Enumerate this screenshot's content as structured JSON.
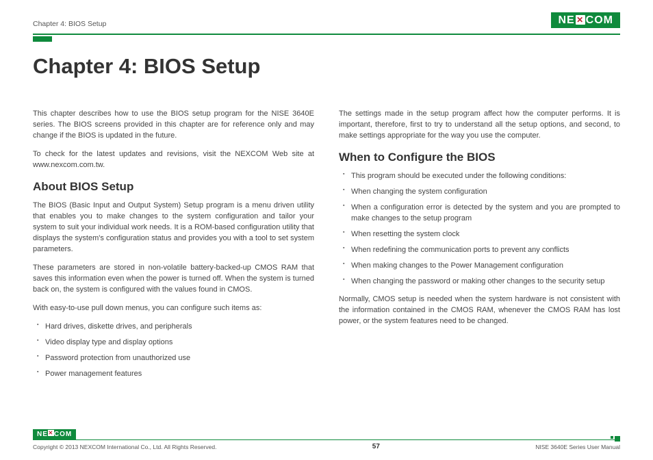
{
  "brand": {
    "pre": "NE",
    "mid": "✕",
    "post": "COM"
  },
  "header": {
    "chapter_ref": "Chapter 4: BIOS Setup"
  },
  "title": "Chapter 4: BIOS Setup",
  "left": {
    "intro1": "This chapter describes how to use the BIOS setup program for the NISE 3640E series. The BIOS screens provided in this chapter are for reference only and may change if the BIOS is updated in the future.",
    "intro2": "To check for the latest updates and revisions, visit the NEXCOM Web site at www.nexcom.com.tw.",
    "h_about": "About BIOS Setup",
    "about1": "The BIOS (Basic Input and Output System) Setup program is a menu driven utility that enables you to make changes to the system configuration and tailor your system to suit your individual work needs. It is a ROM-based configuration utility that displays the system's configuration status and provides you with a tool to set system parameters.",
    "about2": "These parameters are stored in non-volatile battery-backed-up CMOS RAM that saves this information even when the power is turned off. When the system is turned back on, the system is configured with the values found in CMOS.",
    "about3": "With easy-to-use pull down menus, you can configure such items as:",
    "items": [
      "Hard drives, diskette drives, and peripherals",
      "Video display type and display options",
      "Password protection from unauthorized use",
      "Power management features"
    ]
  },
  "right": {
    "intro": "The settings made in the setup program affect how the computer performs. It is important, therefore, first to try to understand all the setup options, and second, to make settings appropriate for the way you use the computer.",
    "h_when": "When to Configure the BIOS",
    "items": [
      "This program should be executed under the following conditions:",
      "When changing the system configuration",
      "When a configuration error is detected by the system and you are prompted to make changes to the setup program",
      "When resetting the system clock",
      "When redefining the communication ports to prevent any conflicts",
      "When making changes to the Power Management configuration",
      "When changing the password or making other changes to the security setup"
    ],
    "outro": "Normally, CMOS setup is needed when the system hardware is not consistent with the information contained in the CMOS RAM, whenever the CMOS RAM has lost power, or the system features need to be changed."
  },
  "footer": {
    "copyright": "Copyright © 2013 NEXCOM International Co., Ltd. All Rights Reserved.",
    "page": "57",
    "manual": "NISE 3640E Series User Manual"
  }
}
